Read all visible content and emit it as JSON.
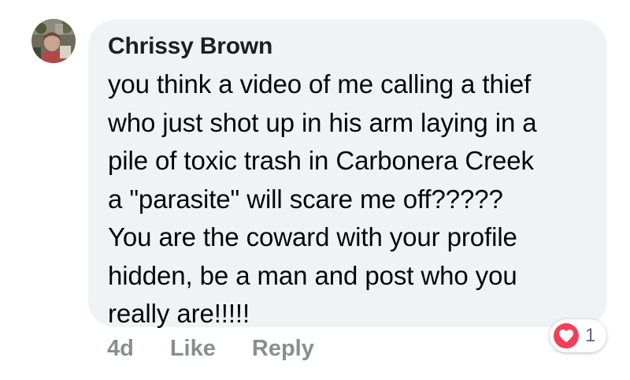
{
  "comment": {
    "author": "Chrissy Brown",
    "lines": [
      "you think a video of me calling a thief",
      "who just shot up in his arm laying in a",
      "pile of toxic trash in Carbonera Creek",
      "a \"parasite\" will scare me off?????",
      "You are the coward with your profile",
      "hidden, be a man and post who you",
      "really are!!!!!"
    ]
  },
  "actions": {
    "timestamp": "4d",
    "like_label": "Like",
    "reply_label": "Reply"
  },
  "reactions": {
    "icon": "heart-icon",
    "count": "1",
    "color": "#f33e58"
  },
  "colors": {
    "bubble": "#f0f2f5",
    "author": "#1c1e21",
    "text": "#050505",
    "muted": "#8a8d91"
  }
}
